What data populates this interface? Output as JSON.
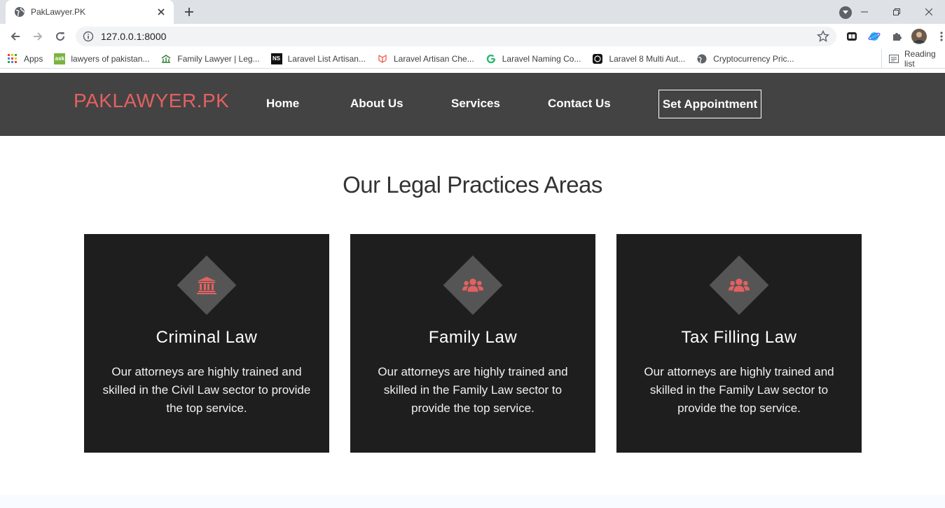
{
  "browser": {
    "tab_title": "PakLawyer.PK",
    "url": "127.0.0.1:8000",
    "bookmarks": [
      {
        "label": "Apps",
        "icon": "apps-grid-icon"
      },
      {
        "label": "lawyers of pakistan...",
        "icon": "ask-icon"
      },
      {
        "label": "Family Lawyer | Leg...",
        "icon": "family-lawyer-icon"
      },
      {
        "label": "Laravel List Artisan...",
        "icon": "ns-icon"
      },
      {
        "label": "Laravel Artisan Che...",
        "icon": "laravel-icon"
      },
      {
        "label": "Laravel Naming Co...",
        "icon": "g-icon"
      },
      {
        "label": "Laravel 8 Multi Aut...",
        "icon": "code-icon"
      },
      {
        "label": "Cryptocurrency Pric...",
        "icon": "globe-icon"
      }
    ],
    "reading_list": "Reading list"
  },
  "site": {
    "logo": "PAKLAWYER.PK",
    "nav": [
      "Home",
      "About Us",
      "Services",
      "Contact Us"
    ],
    "cta": "Set Appointment",
    "section_title": "Our Legal Practices Areas",
    "cards": [
      {
        "title": "Criminal Law",
        "text": "Our attorneys are highly trained and skilled in the Civil Law sector to provide the top service.",
        "icon": "bank-icon"
      },
      {
        "title": "Family Law",
        "text": "Our attorneys are highly trained and skilled in the Family Law sector to provide the top service.",
        "icon": "users-icon"
      },
      {
        "title": "Tax Filling Law",
        "text": "Our attorneys are highly trained and skilled in the Family Law sector to provide the top service.",
        "icon": "users-icon"
      }
    ]
  },
  "colors": {
    "accent": "#e36160",
    "header_bg": "#434343",
    "card_bg": "#1e1e1e"
  }
}
